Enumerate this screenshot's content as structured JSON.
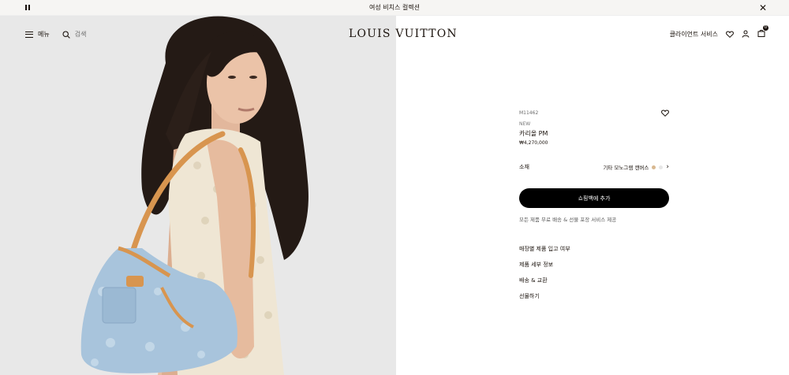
{
  "announcement": {
    "text": "여성 비치스 컬렉션"
  },
  "header": {
    "logo": "LOUIS VUITTON",
    "menu_label": "메뉴",
    "search_label": "검색",
    "client_service_label": "클라이언트 서비스",
    "bag_count": "0"
  },
  "product": {
    "sku": "M11462",
    "badge": "NEW",
    "name": "카리올 PM",
    "price": "₩4,270,000",
    "material_label": "소재",
    "material_value": "기타 모노그램 캔버스",
    "add_to_bag_label": "쇼핑백에 추가",
    "service_notice": "모든 제품 무료 배송 & 선물 포장 서비스 제공"
  },
  "info_links": [
    {
      "label": "매장별 제품 입고 여부"
    },
    {
      "label": "제품 세부 정보"
    },
    {
      "label": "배송 & 교환"
    },
    {
      "label": "선물하기"
    }
  ],
  "colors": {
    "accent": "#000000",
    "text": "#19110b",
    "hero_bg": "#e6e6e6",
    "bag_denim": "#a8c4dc",
    "bag_leather": "#d8954f"
  },
  "icons": {
    "pause": "pause-icon",
    "close": "close-icon",
    "menu": "hamburger-icon",
    "search": "search-icon",
    "wishlist": "heart-icon",
    "account": "user-icon",
    "bag": "shopping-bag-icon",
    "chevron": "chevron-right-icon"
  }
}
